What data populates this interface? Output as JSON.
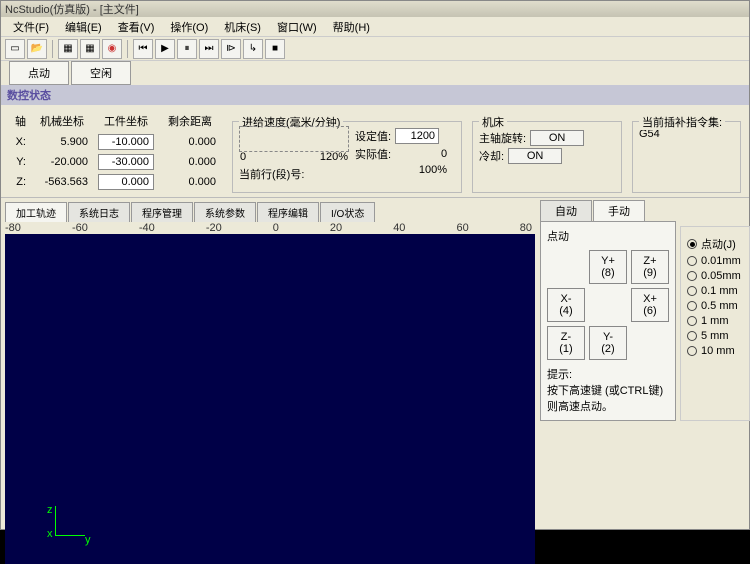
{
  "title": "NcStudio(仿真版) - [主文件]",
  "menu": [
    "文件(F)",
    "编辑(E)",
    "查看(V)",
    "操作(O)",
    "机床(S)",
    "窗口(W)",
    "帮助(H)"
  ],
  "mode_tabs": [
    "点动",
    "空闲"
  ],
  "section": "数控状态",
  "coord": {
    "axis_hdr": "轴",
    "mech_hdr": "机械坐标",
    "work_hdr": "工件坐标",
    "remain_hdr": "剩余距离",
    "rows": [
      {
        "axis": "X:",
        "mech": "5.900",
        "work": "-10.000",
        "remain": "0.000"
      },
      {
        "axis": "Y:",
        "mech": "-20.000",
        "work": "-30.000",
        "remain": "0.000"
      },
      {
        "axis": "Z:",
        "mech": "-563.563",
        "work": "0.000",
        "remain": "0.000"
      }
    ]
  },
  "feed": {
    "title": "进给速度(毫米/分钟)",
    "tick0": "0",
    "tick1": "120%",
    "set_label": "设定值:",
    "set_val": "1200",
    "act_label": "实际值:",
    "act_val": "0",
    "pct": "100%",
    "line_label": "当前行(段)号:"
  },
  "machine": {
    "title": "机床",
    "spindle_label": "主轴旋转:",
    "spindle_val": "ON",
    "cool_label": "冷却:",
    "cool_val": "ON"
  },
  "modal": {
    "title": "当前插补指令集:",
    "val": "G54"
  },
  "sub_tabs": [
    "加工轨迹",
    "系统日志",
    "程序管理",
    "系统参数",
    "程序编辑",
    "I/O状态"
  ],
  "ruler_ticks": [
    "-80",
    "-60",
    "-40",
    "-20",
    "0",
    "20",
    "40",
    "60",
    "80"
  ],
  "right_tabs": [
    "自动",
    "手动"
  ],
  "jog": {
    "title": "点动",
    "btns": {
      "yp": "Y+",
      "yp_k": "(8)",
      "zp": "Z+",
      "zp_k": "(9)",
      "xm": "X-",
      "xm_k": "(4)",
      "xp": "X+",
      "xp_k": "(6)",
      "zm": "Z-",
      "zm_k": "(1)",
      "ym": "Y-",
      "ym_k": "(2)"
    },
    "hint_label": "提示:",
    "hint": "按下高速键 (或CTRL键)则高速点动。"
  },
  "steps": {
    "label0": "点动(J)",
    "opts": [
      "0.01mm",
      "0.05mm",
      "0.1 mm",
      "0.5 mm",
      "1   mm",
      "5   mm",
      "10 mm"
    ]
  }
}
